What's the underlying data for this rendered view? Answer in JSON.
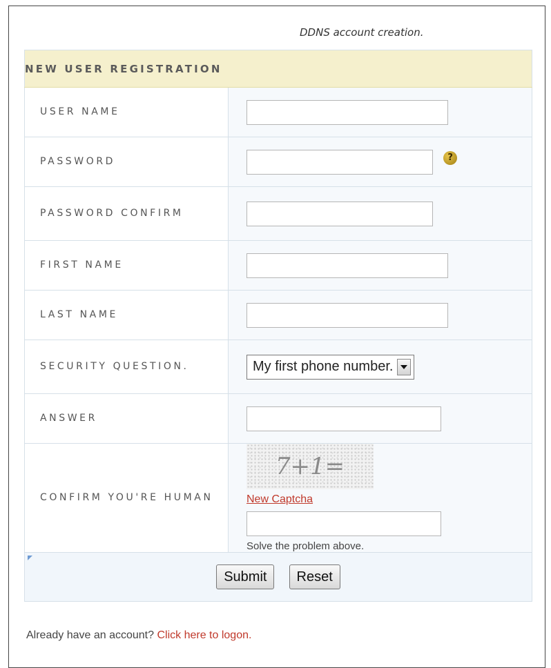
{
  "caption": "DDNS account creation.",
  "form": {
    "title": "NEW USER REGISTRATION",
    "fields": {
      "username": {
        "label": "USER NAME",
        "value": ""
      },
      "password": {
        "label": "PASSWORD",
        "value": "",
        "help": "?"
      },
      "password_confirm": {
        "label": "PASSWORD CONFIRM",
        "value": ""
      },
      "first_name": {
        "label": "FIRST NAME",
        "value": ""
      },
      "last_name": {
        "label": "LAST NAME",
        "value": ""
      },
      "security_question": {
        "label": "SECURITY QUESTION.",
        "selected": "My first phone number."
      },
      "answer": {
        "label": "ANSWER",
        "value": ""
      }
    },
    "captcha": {
      "label": "CONFIRM YOU'RE HUMAN",
      "image_text": "7+1=",
      "new_captcha_label": "New Captcha",
      "value": "",
      "hint": "Solve the problem above."
    },
    "buttons": {
      "submit": "Submit",
      "reset": "Reset"
    }
  },
  "footer": {
    "text": "Already have an account? ",
    "link": "Click here to logon."
  },
  "colors": {
    "header_bg": "#f5f0cd",
    "link": "#c0392b",
    "field_bg": "#f6f9fc"
  }
}
